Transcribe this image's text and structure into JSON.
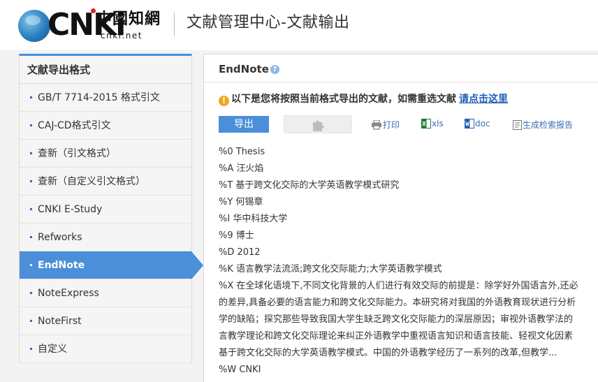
{
  "header": {
    "logo_text_latin": "CNKi",
    "logo_text_cn": "中國知網",
    "logo_domain": "cnki.net",
    "page_title": "文献管理中心-文献输出"
  },
  "sidebar": {
    "title": "文献导出格式",
    "items": [
      {
        "label": "GB/T 7714-2015 格式引文",
        "active": false
      },
      {
        "label": "CAJ-CD格式引文",
        "active": false
      },
      {
        "label": "查新（引文格式）",
        "active": false
      },
      {
        "label": "查新（自定义引文格式）",
        "active": false
      },
      {
        "label": "CNKI E-Study",
        "active": false
      },
      {
        "label": "Refworks",
        "active": false
      },
      {
        "label": "EndNote",
        "active": true
      },
      {
        "label": "NoteExpress",
        "active": false
      },
      {
        "label": "NoteFirst",
        "active": false
      },
      {
        "label": "自定义",
        "active": false
      }
    ],
    "accent_color": "#4a8fd8"
  },
  "main": {
    "title": "EndNote",
    "help_icon": "question-icon",
    "notice_text": "以下是您将按照当前格式导出的文献，如需重选文献",
    "notice_link": "请点击这里",
    "toolbar": {
      "export_label": "导出",
      "plugin_icon": "puzzle-icon",
      "print_label": "打印",
      "xls_label": "xls",
      "doc_label": "doc",
      "report_label": "生成检索报告"
    },
    "record_lines": [
      "%0 Thesis",
      "%A 汪火焰",
      "%T 基于跨文化交际的大学英语教学模式研究",
      "%Y 何锡章",
      "%I 华中科技大学",
      "%9 博士",
      "%D 2012",
      "%K 语言教学法流派;跨文化交际能力;大学英语教学模式",
      "%X 在全球化语境下,不同文化背景的人们进行有效交际的前提是：除学好外国语言外,还必",
      "的差异,具备必要的语言能力和跨文化交际能力。本研究将对我国的外语教育现状进行分析",
      "学的缺陷；探究那些导致我国大学生缺乏跨文化交际能力的深层原因；审视外语教学法的",
      "言教学理论和跨文化交际理论来纠正外语教学中重视语言知识和语言技能、轻视文化因素",
      "基于跨文化交际的大学英语教学模式。中国的外语教学经历了一系列的改革,但教学...",
      "%W CNKI"
    ]
  }
}
